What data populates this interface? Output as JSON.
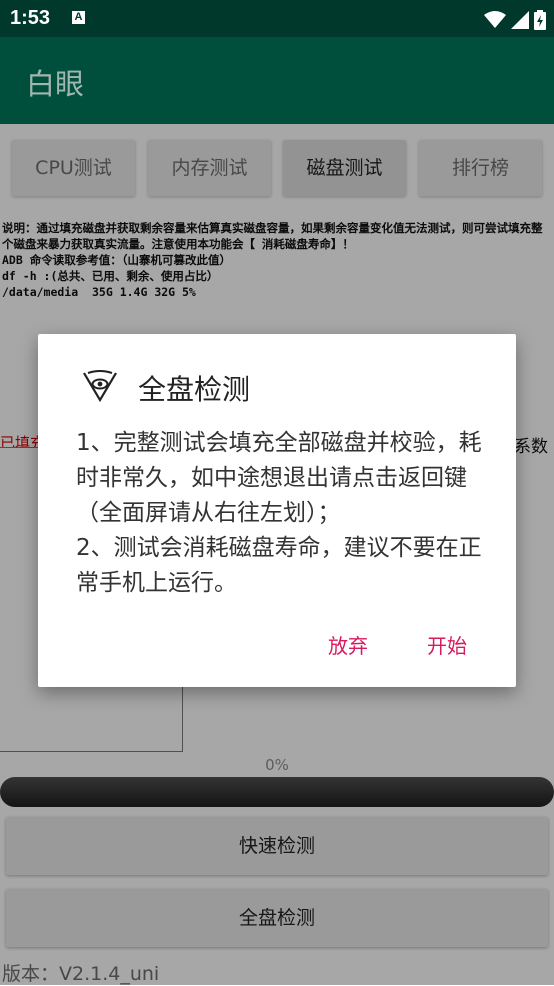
{
  "status_bar": {
    "time": "1:53",
    "notification": "A"
  },
  "app_bar": {
    "title": "白眼"
  },
  "tabs": [
    {
      "label": "CPU测试"
    },
    {
      "label": "内存测试"
    },
    {
      "label": "磁盘测试"
    },
    {
      "label": "排行榜"
    }
  ],
  "description": {
    "line1": "说明：通过填充磁盘并获取剩余容量来估算真实磁盘容量，如果剩余容量变化值无法测试，则可尝试填充整个磁盘来暴力获取真实流量。注意使用本功能会【 消耗磁盘寿命】！",
    "line2": "ADB 命令读取参考值：（山寨机可篡改此值）",
    "line3": "df -h :(总共、已用、剩余、使用占比）",
    "line4": "/data/media  35G 1.4G 32G 5%"
  },
  "filled_label": "已填充",
  "coef_label": "系数",
  "progress": {
    "percent_text": "0%",
    "value": 0
  },
  "buttons": {
    "quick": "快速检测",
    "full": "全盘检测"
  },
  "version": "版本：V2.1.4_uni",
  "dialog": {
    "title": "全盘检测",
    "message_line1": "1、完整测试会填充全部磁盘并校验，耗时非常久，如中途想退出请点击返回键（全面屏请从右往左划）；",
    "message_line2": "2、测试会消耗磁盘寿命，建议不要在正常手机上运行。",
    "cancel": "放弃",
    "confirm": "开始"
  },
  "colors": {
    "status_bar": "#00382c",
    "app_bar": "#004f3d",
    "accent": "#d81b60"
  }
}
